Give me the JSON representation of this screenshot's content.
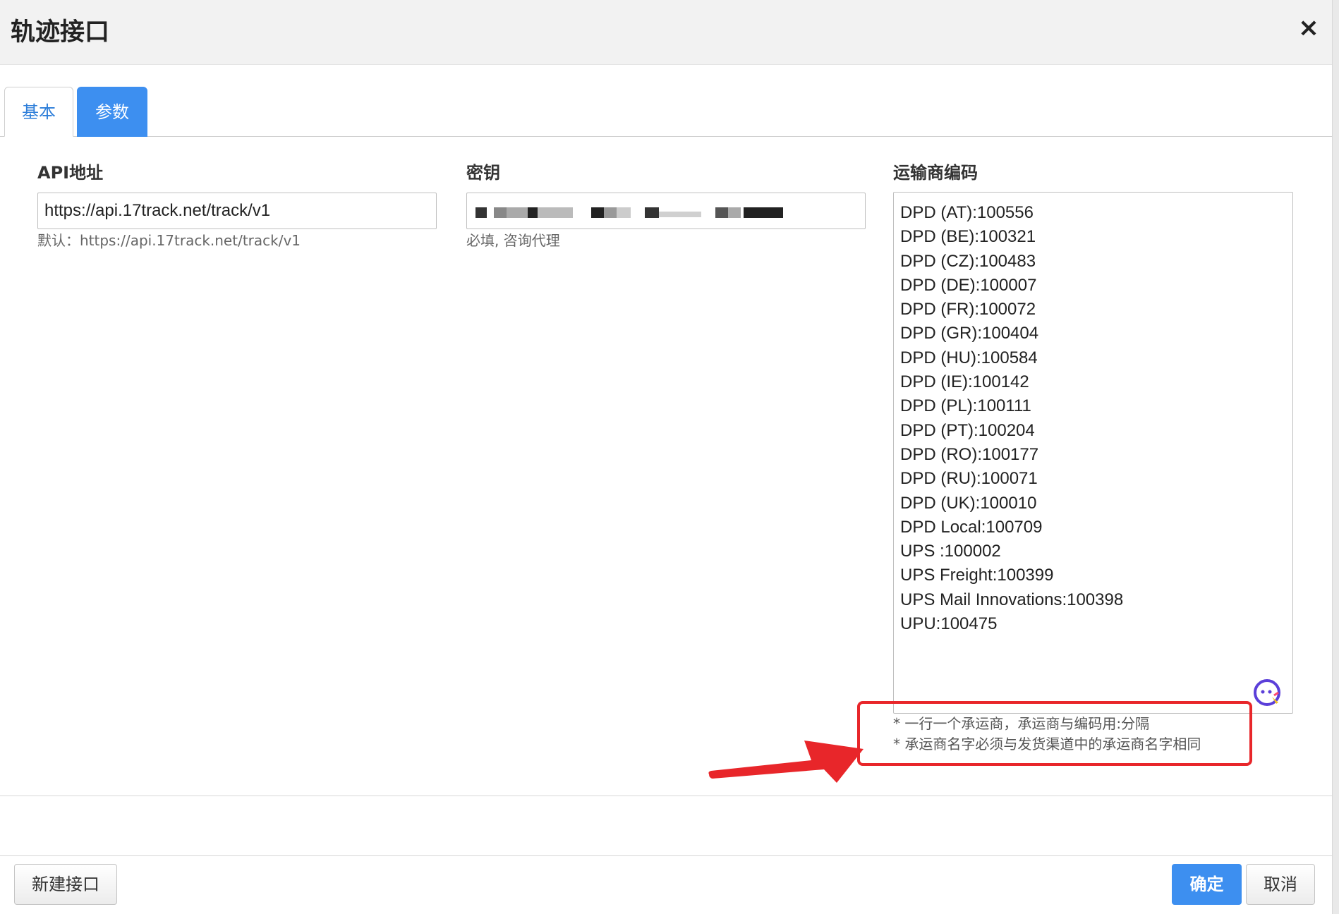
{
  "dialog": {
    "title": "轨迹接口",
    "close_label": "×"
  },
  "tabs": [
    {
      "label": "基本",
      "active": false
    },
    {
      "label": "参数",
      "active": true
    }
  ],
  "fields": {
    "api_url": {
      "label": "API地址",
      "value": "https://api.17track.net/track/v1",
      "help": "默认：https://api.17track.net/track/v1"
    },
    "secret": {
      "label": "密钥",
      "value": "",
      "help": "必填, 咨询代理"
    },
    "carrier_codes": {
      "label": "运输商编码",
      "value": "DPD (AT):100556\nDPD (BE):100321\nDPD (CZ):100483\nDPD (DE):100007\nDPD (FR):100072\nDPD (GR):100404\nDPD (HU):100584\nDPD (IE):100142\nDPD (PL):100111\nDPD (PT):100204\nDPD (RO):100177\nDPD (RU):100071\nDPD (UK):100010\nDPD Local:100709\nUPS :100002\nUPS Freight:100399\nUPS Mail Innovations:100398\nUPU:100475",
      "notes": [
        "* 一行一个承运商，承运商与编码用:分隔",
        "* 承运商名字必须与发货渠道中的承运商名字相同"
      ]
    }
  },
  "footer": {
    "new_button": "新建接口",
    "confirm_button": "确定",
    "cancel_button": "取消"
  },
  "colors": {
    "primary": "#3d8ff0",
    "annotation_red": "#e8262a",
    "header_bg": "#f2f2f2"
  },
  "icons": {
    "close": "close-icon",
    "assistant": "grammar-assistant-icon",
    "annotation_arrow": "red-arrow-annotation"
  }
}
